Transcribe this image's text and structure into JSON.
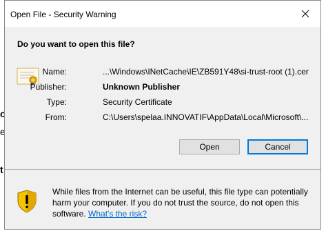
{
  "background": {
    "fragments": [
      "o",
      "e",
      "t"
    ]
  },
  "dialog": {
    "title": "Open File - Security Warning",
    "heading": "Do you want to open this file?",
    "fields": [
      {
        "label": "Name:",
        "value": "...\\Windows\\INetCache\\IE\\ZB591Y48\\si-trust-root (1).cer",
        "bold": false
      },
      {
        "label": "Publisher:",
        "value": "Unknown Publisher",
        "bold": true
      },
      {
        "label": "Type:",
        "value": "Security Certificate",
        "bold": false
      },
      {
        "label": "From:",
        "value": "C:\\Users\\spelaa.INNOVATIF\\AppData\\Local\\Microsoft\\...",
        "bold": false
      }
    ],
    "buttons": {
      "open": "Open",
      "cancel": "Cancel"
    },
    "warning": {
      "text": "While files from the Internet can be useful, this file type can potentially harm your computer. If you do not trust the source, do not open this software.",
      "link": "What's the risk?"
    },
    "icons": {
      "close": "close-icon",
      "file": "certificate-icon",
      "warning": "warning-shield-icon"
    },
    "colors": {
      "accent": "#0078d7",
      "link": "#0066cc",
      "shield_yellow": "#f5c400"
    }
  }
}
